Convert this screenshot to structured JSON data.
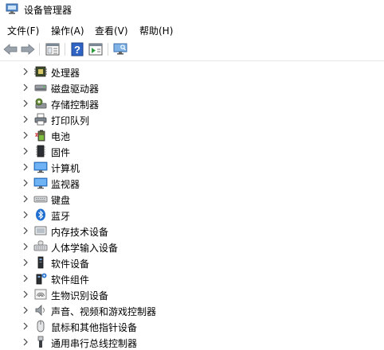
{
  "window": {
    "title": "设备管理器"
  },
  "menu": [
    "文件(F)",
    "操作(A)",
    "查看(V)",
    "帮助(H)"
  ],
  "toolbar": {
    "buttons": [
      "back-icon",
      "forward-icon",
      "properties-icon",
      "help-icon",
      "run-icon",
      "monitor-icon"
    ]
  },
  "tree": {
    "items": [
      {
        "label": "处理器",
        "icon": "processor-icon"
      },
      {
        "label": "磁盘驱动器",
        "icon": "disk-drive-icon"
      },
      {
        "label": "存储控制器",
        "icon": "storage-controller-icon"
      },
      {
        "label": "打印队列",
        "icon": "printer-icon"
      },
      {
        "label": "电池",
        "icon": "battery-icon"
      },
      {
        "label": "固件",
        "icon": "firmware-icon"
      },
      {
        "label": "计算机",
        "icon": "computer-icon"
      },
      {
        "label": "监视器",
        "icon": "monitor-icon"
      },
      {
        "label": "键盘",
        "icon": "keyboard-icon"
      },
      {
        "label": "蓝牙",
        "icon": "bluetooth-icon"
      },
      {
        "label": "内存技术设备",
        "icon": "memory-device-icon"
      },
      {
        "label": "人体学输入设备",
        "icon": "hid-icon"
      },
      {
        "label": "软件设备",
        "icon": "software-device-icon"
      },
      {
        "label": "软件组件",
        "icon": "software-component-icon"
      },
      {
        "label": "生物识别设备",
        "icon": "biometric-icon"
      },
      {
        "label": "声音、视频和游戏控制器",
        "icon": "sound-icon"
      },
      {
        "label": "鼠标和其他指针设备",
        "icon": "mouse-icon"
      },
      {
        "label": "通用串行总线控制器",
        "icon": "usb-icon"
      }
    ]
  }
}
